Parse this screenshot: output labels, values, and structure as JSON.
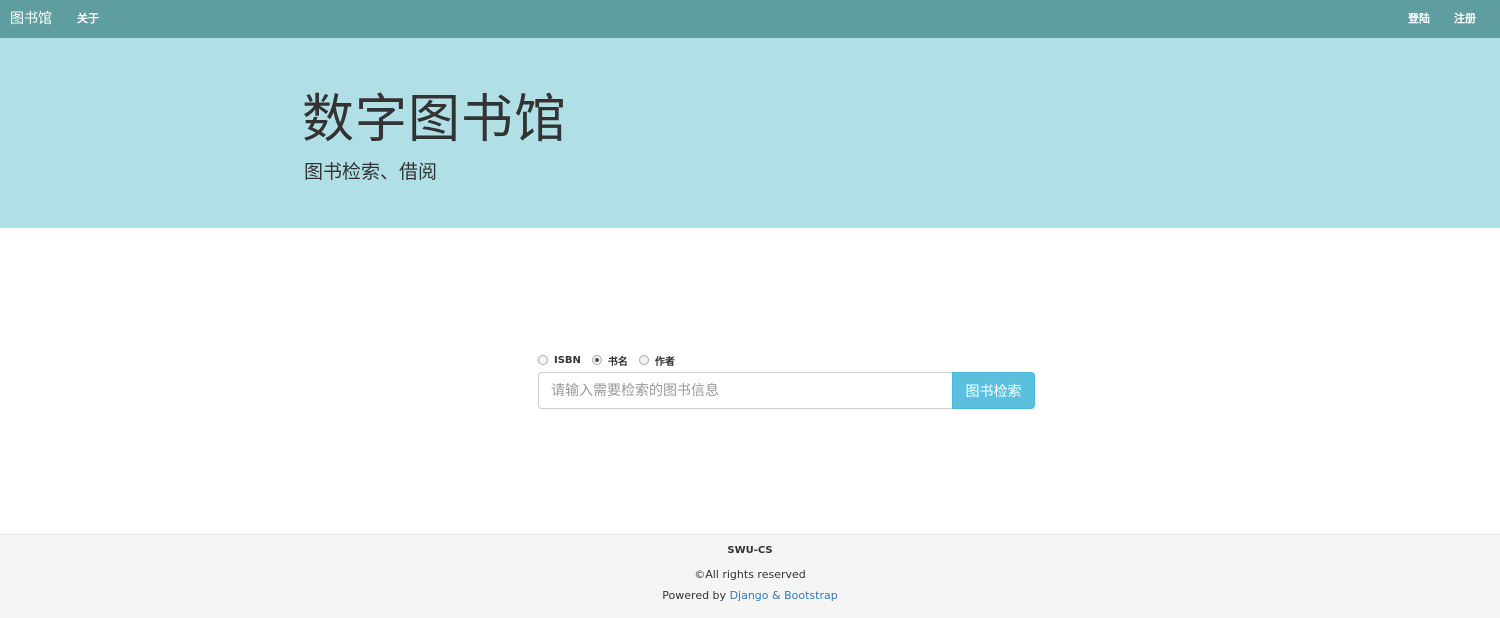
{
  "navbar": {
    "brand": "图书馆",
    "about": "关于",
    "login": "登陆",
    "register": "注册"
  },
  "jumbotron": {
    "title": "数字图书馆",
    "subtitle": "图书检索、借阅"
  },
  "search": {
    "options": [
      {
        "label": "ISBN",
        "checked": false
      },
      {
        "label": "书名",
        "checked": true
      },
      {
        "label": "作者",
        "checked": false
      }
    ],
    "placeholder": "请输入需要检索的图书信息",
    "value": "",
    "button_label": "图书检索"
  },
  "footer": {
    "brand": "SWU-CS",
    "rights": "©All rights reserved",
    "powered_prefix": "Powered by",
    "powered_link": "Django & Bootstrap"
  },
  "colors": {
    "navbar": "#5f9ea0",
    "jumbotron": "#b0e0e6",
    "button": "#5bc0de",
    "link": "#337ab7"
  }
}
